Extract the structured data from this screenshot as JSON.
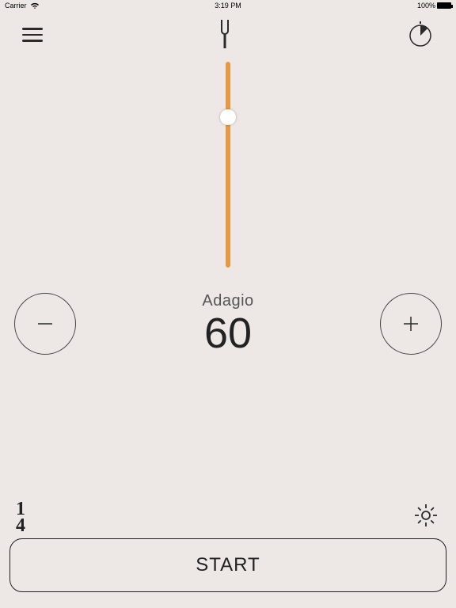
{
  "status": {
    "carrier": "Carrier",
    "wifi": "",
    "time": "3:19 PM",
    "battery_pct": "100%"
  },
  "tempo": {
    "marking": "Adagio",
    "bpm": "60"
  },
  "time_signature": {
    "numerator": "1",
    "denominator": "4"
  },
  "controls": {
    "start_label": "START"
  },
  "icons": {
    "menu": "menu-icon",
    "tuning_fork": "tuning-fork-icon",
    "timer": "timer-icon",
    "minus": "minus-icon",
    "plus": "plus-icon",
    "settings": "gear-icon"
  },
  "colors": {
    "accent": "#e79843",
    "bg": "#ede7e6",
    "stroke": "#2a2a2a"
  }
}
